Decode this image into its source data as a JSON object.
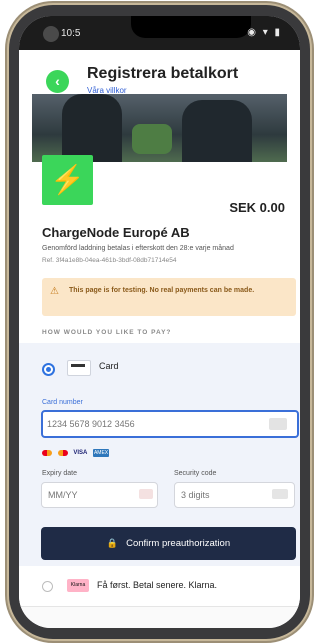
{
  "status_bar": {
    "time": "10:5",
    "icons": "◉ ▾ ▮"
  },
  "header": {
    "title": "Registrera betalkort",
    "terms_link": "Våra villkor",
    "back_icon": "arrow-left"
  },
  "merchant": {
    "amount": "SEK 0.00",
    "name": "ChargeNode Europé AB",
    "description": "Genomförd laddning betalas i efterskott den 28:e varje månad",
    "reference": "Ref. 3f4a1e8b-04ea-461b-3bdf-08db71714e54"
  },
  "warning": {
    "text": "This page is for testing. No real payments can be made."
  },
  "payment": {
    "heading": "HOW WOULD YOU LIKE TO PAY?",
    "card": {
      "label": "Card",
      "card_number_label": "Card number",
      "card_number_placeholder": "1234 5678 9012 3456",
      "brands": [
        "mastercard",
        "maestro",
        "VISA",
        "AMEX"
      ],
      "expiry_label": "Expiry date",
      "expiry_placeholder": "MM/YY",
      "security_label": "Security code",
      "security_placeholder": "3 digits",
      "confirm_label": "Confirm preauthorization"
    },
    "klarna": {
      "logo_text": "Klarna",
      "label": "Få først. Betal senere. Klarna."
    }
  },
  "colors": {
    "accent_green": "#3bd65a",
    "primary_blue": "#3a6fd8",
    "button_navy": "#1f2b46",
    "warning_bg": "#fbe6c8"
  }
}
